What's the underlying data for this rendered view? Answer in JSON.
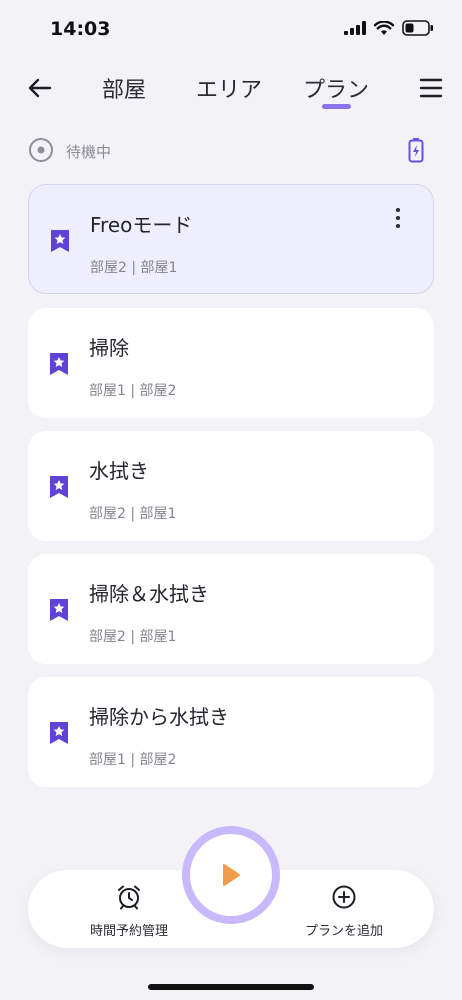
{
  "status_bar": {
    "time": "14:03"
  },
  "nav": {
    "tabs": [
      {
        "label": "部屋"
      },
      {
        "label": "エリア"
      },
      {
        "label": "プラン"
      }
    ],
    "active_tab": "プラン"
  },
  "robot_status": {
    "label": "待機中"
  },
  "plans": [
    {
      "title": "Freoモード",
      "rooms": "部屋2 | 部屋1"
    },
    {
      "title": "掃除",
      "rooms": "部屋1 | 部屋2"
    },
    {
      "title": "水拭き",
      "rooms": "部屋2 | 部屋1"
    },
    {
      "title": "掃除＆水拭き",
      "rooms": "部屋2 | 部屋1"
    },
    {
      "title": "掃除から水拭き",
      "rooms": "部屋1 | 部屋2"
    }
  ],
  "bottom_bar": {
    "schedule_label": "時間予約管理",
    "add_plan_label": "プランを追加"
  },
  "colors": {
    "accent": "#8a73ea",
    "bookmark": "#5e43d6",
    "play": "#f19a4a",
    "background": "#f3f3f7"
  }
}
